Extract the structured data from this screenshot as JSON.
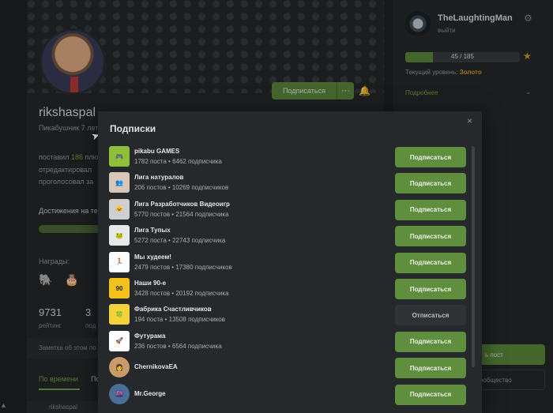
{
  "profile": {
    "username": "rikshaspal",
    "tagline": "Пикабушник 7 лет",
    "subscribe_label": "Подписаться",
    "more_label": "···",
    "stats_lines": [
      "поставил 186 плю",
      "отредактировал",
      "проголосовал за"
    ],
    "stats_highlight": "186",
    "achievements_label": "Достижения на те",
    "awards_label": "Награды:",
    "rating_value": "9731",
    "rating_label": "рейтинг",
    "second_value": "3",
    "second_label": "под",
    "note_label": "Заметка об этом по",
    "tab_active": "По времени",
    "tab_other": "По",
    "bottom_user": "rikshaspal"
  },
  "sidebar": {
    "user_name": "TheLaughtingMan",
    "logout_label": "выйти",
    "rating_progress": "45 / 185",
    "rating_fraction": 0.243,
    "level_label": "Текущий уровень:",
    "level_value": "Золото",
    "more_label": "Подробнее",
    "post_button": "ь пост",
    "community_button": "ообщество"
  },
  "modal": {
    "title": "Подписки",
    "close_label": "×",
    "items": [
      {
        "name": "pikabu GAMES",
        "meta": "1782 поста • 6462 подписчика",
        "button": "Подписаться",
        "subscribed": false,
        "avatar_color": "#8fbf3a",
        "avatar_text": "🎮"
      },
      {
        "name": "Лига натуралов",
        "meta": "206 постов • 10269 подписчиков",
        "button": "Подписаться",
        "subscribed": false,
        "avatar_color": "#d8c6b8",
        "avatar_text": "👥"
      },
      {
        "name": "Лига Разработчиков Видеоигр",
        "meta": "5770 постов • 21564 подписчика",
        "button": "Подписаться",
        "subscribed": false,
        "avatar_color": "#cfcfcf",
        "avatar_text": "🐱"
      },
      {
        "name": "Лига Тупых",
        "meta": "5272 поста • 22743 подписчика",
        "button": "Подписаться",
        "subscribed": false,
        "avatar_color": "#e8e8e8",
        "avatar_text": "🐸"
      },
      {
        "name": "Мы худеем!",
        "meta": "2479 постов • 17380 подписчиков",
        "button": "Подписаться",
        "subscribed": false,
        "avatar_color": "#ffffff",
        "avatar_text": "🏃"
      },
      {
        "name": "Наши 90-е",
        "meta": "3428 постов • 20192 подписчика",
        "button": "Подписаться",
        "subscribed": false,
        "avatar_color": "#f2c21b",
        "avatar_text": "90"
      },
      {
        "name": "Фабрика Счастливчиков",
        "meta": "194 поста • 13508 подписчиков",
        "button": "Отписаться",
        "subscribed": true,
        "avatar_color": "#f4d23a",
        "avatar_text": "🍀"
      },
      {
        "name": "Футурама",
        "meta": "236 постов • 6564 подписчика",
        "button": "Подписаться",
        "subscribed": false,
        "avatar_color": "#ffffff",
        "avatar_text": "🚀"
      },
      {
        "name": "ChernikovaEA",
        "meta": "",
        "button": "Подписаться",
        "subscribed": false,
        "avatar_color": "#c99a6a",
        "avatar_text": "👩"
      },
      {
        "name": "Mr.George",
        "meta": "",
        "button": "Подписаться",
        "subscribed": false,
        "avatar_color": "#4a6e96",
        "avatar_text": "🌆"
      }
    ]
  }
}
